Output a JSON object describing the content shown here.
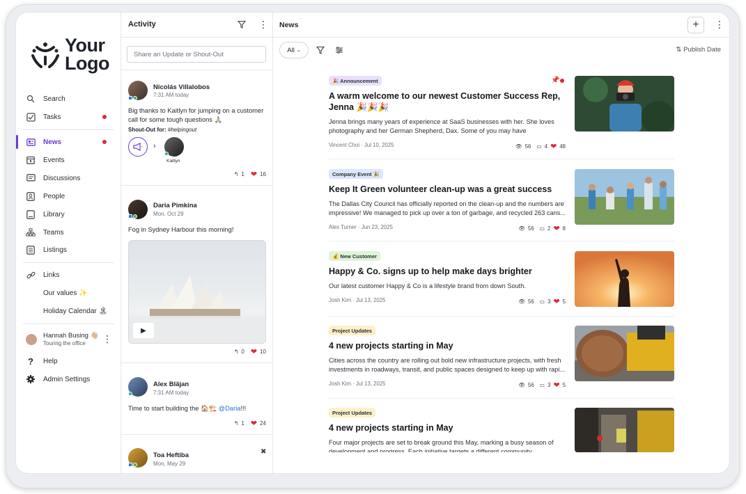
{
  "sidebar": {
    "logo": {
      "line1": "Your",
      "line2": "Logo"
    },
    "items": [
      {
        "label": "Search",
        "icon": "search-icon"
      },
      {
        "label": "Tasks",
        "icon": "checkbox-icon"
      },
      {
        "label": "News",
        "icon": "news-icon"
      },
      {
        "label": "Events",
        "icon": "calendar-icon"
      },
      {
        "label": "Discussions",
        "icon": "discussions-icon"
      },
      {
        "label": "People",
        "icon": "people-icon"
      },
      {
        "label": "Library",
        "icon": "library-icon"
      },
      {
        "label": "Teams",
        "icon": "teams-icon"
      },
      {
        "label": "Listings",
        "icon": "listings-icon"
      },
      {
        "label": "Links",
        "icon": "link-icon"
      }
    ],
    "links": [
      {
        "label": "Our values ✨"
      },
      {
        "label": "Holiday Calendar 🏝"
      }
    ],
    "user": {
      "name": "Hannah Busing 👋🏼",
      "status": "Touring the office"
    },
    "help": "Help",
    "admin": "Admin Settings",
    "accent": "#6a3ad8"
  },
  "activity": {
    "title": "Activity",
    "share_placeholder": "Share an Update or Shout-Out",
    "posts": [
      {
        "name": "Nicolás Villalobos",
        "time": "7:31 AM today",
        "text": "Big thanks to Kaitlyn for jumping on a customer call for some tough questions 🙏🏼",
        "shoutout_label": "Shout-Out for:",
        "shoutout_tag": "#helpingout",
        "recipient": "Kaitlyn",
        "replies": "1",
        "likes": "16"
      },
      {
        "name": "Daria Pimkina",
        "time": "Mon, Oct 29",
        "text": "Fog in Sydney Harbour this morning!",
        "replies": "0",
        "likes": "10"
      },
      {
        "name": "Alex Blăjan",
        "time": "7:31 AM today",
        "text_pre": "Time to start building the 🏠🏗️ ",
        "mention": "@Daria",
        "text_post": "!!!",
        "replies": "1",
        "likes": "24"
      },
      {
        "name": "Toa Heftiba",
        "time": "Mon, May 29"
      }
    ]
  },
  "news": {
    "title": "News",
    "filter_all": "All",
    "sort_label": "Publish Date",
    "items": [
      {
        "badge": "🎉 Announcement",
        "badge_color": "#e8e0fb",
        "title": "A warm welcome to our newest Customer Success Rep, Jenna 🎉🎉🎉",
        "text": "Jenna brings many years of experience at SaaS businesses with her. She loves photography and her German Shepherd, Dax. Some of you may have remembere...",
        "author": "Vincent Choi",
        "date": "Jul 10, 2025",
        "views": "56",
        "comments": "4",
        "likes": "48"
      },
      {
        "badge": "Company Event 🎉",
        "badge_color": "#dbe7fb",
        "title": "Keep It Green volunteer clean-up was a great success",
        "text": "The Dallas City Council has officially reported on the clean-up and the numbers are impressive! We managed to pick up over a ton of garbage, and recycled 263 cans...",
        "author": "Alex Turner",
        "date": "Jun 23, 2025",
        "views": "56",
        "comments": "2",
        "likes": "8"
      },
      {
        "badge": "💰 New Customer",
        "badge_color": "#dff3d8",
        "title": "Happy & Co. signs up to help make days brighter",
        "text": "Our latest customer Happy & Co is a lifestyle brand from down South.",
        "author": "Josh Kim",
        "date": "Jul 13, 2025",
        "views": "56",
        "comments": "3",
        "likes": "5"
      },
      {
        "badge": "Project Updates",
        "badge_color": "#fdf0c8",
        "title": "4 new projects starting in May",
        "text": "Cities across the country are rolling out bold new infrastructure projects, with fresh investments in roadways, transit, and public spaces designed to keep up with rapi...",
        "author": "Josh Kim",
        "date": "Jul 13, 2025",
        "views": "56",
        "comments": "3",
        "likes": "5"
      },
      {
        "badge": "Project Updates",
        "badge_color": "#fdf0c8",
        "title": "4 new projects starting in May",
        "text": "Four major projects are set to break ground this May, marking a busy season of development and progress. Each initiative targets a different community..."
      }
    ]
  }
}
